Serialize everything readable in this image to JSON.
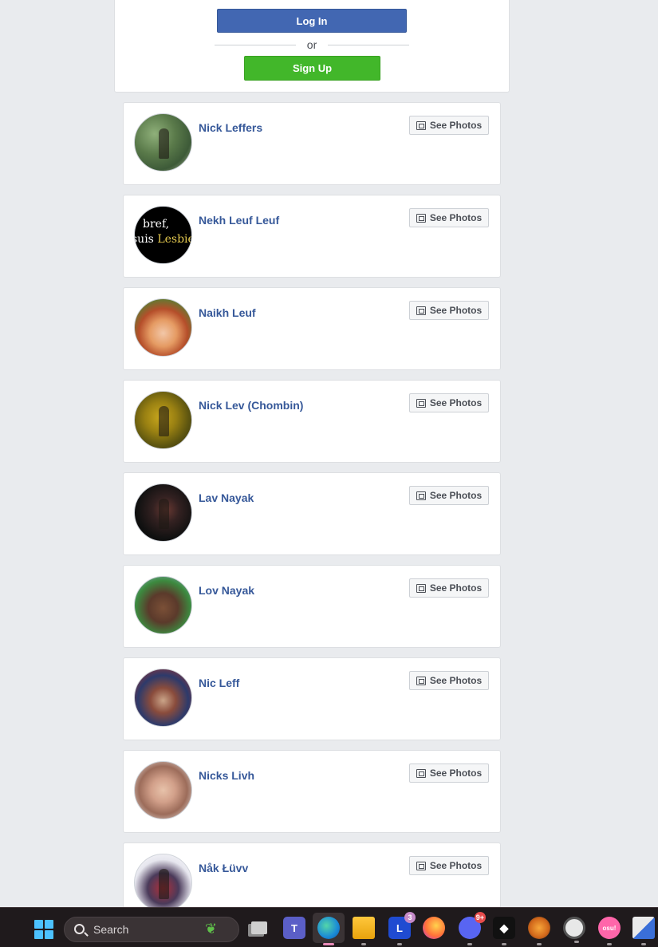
{
  "auth": {
    "login_label": "Log In",
    "or_label": "or",
    "signup_label": "Sign Up"
  },
  "results": [
    {
      "name": "Nick Leffers",
      "action": "See Photos"
    },
    {
      "name": "Nekh Leuf Leuf",
      "action": "See Photos",
      "avatar_text_line1": "bref,",
      "avatar_text_line2_a": "suis ",
      "avatar_text_line2_b": "Lesbien"
    },
    {
      "name": "Naikh Leuf",
      "action": "See Photos"
    },
    {
      "name": "Nick Lev (Chombin)",
      "action": "See Photos"
    },
    {
      "name": "Lav Nayak",
      "action": "See Photos"
    },
    {
      "name": "Lov Nayak",
      "action": "See Photos"
    },
    {
      "name": "Nic Leff",
      "action": "See Photos"
    },
    {
      "name": "Nicks Livh",
      "action": "See Photos"
    },
    {
      "name": "Nåk Łüvv",
      "action": "See Photos"
    }
  ],
  "taskbar": {
    "search_label": "Search",
    "apps": [
      {
        "icon": "task-view-icon"
      },
      {
        "icon": "teams-icon",
        "label": "T"
      },
      {
        "icon": "edge-icon",
        "active": true
      },
      {
        "icon": "file-explorer-icon"
      },
      {
        "icon": "l-app-icon",
        "label": "L",
        "badge": "3"
      },
      {
        "icon": "firefox-icon"
      },
      {
        "icon": "discord-icon",
        "badge": "9+"
      },
      {
        "icon": "tidal-icon"
      },
      {
        "icon": "fl-studio-icon"
      },
      {
        "icon": "clock-app-icon"
      },
      {
        "icon": "osu-icon",
        "label": "osu!"
      },
      {
        "icon": "paint-icon"
      }
    ]
  }
}
